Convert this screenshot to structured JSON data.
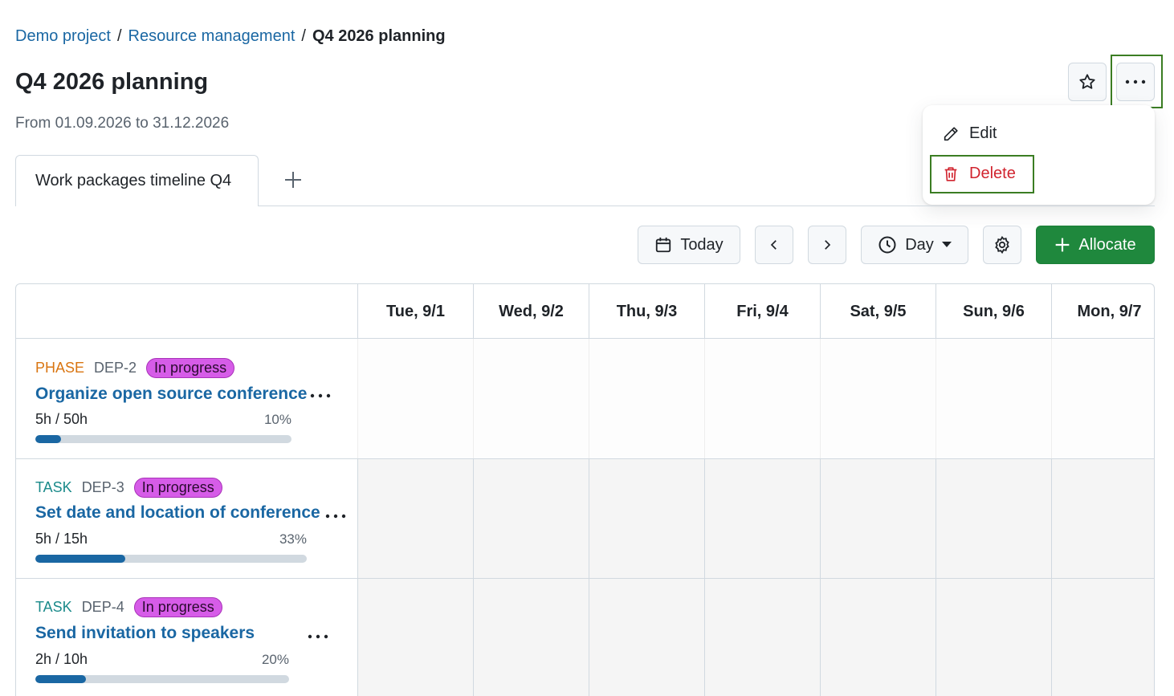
{
  "breadcrumb": {
    "item1": "Demo project",
    "sep1": "/",
    "item2": "Resource management",
    "sep2": "/",
    "current": "Q4 2026 planning"
  },
  "page": {
    "title": "Q4 2026 planning",
    "date_range": "From 01.09.2026 to 31.12.2026"
  },
  "header_actions": {
    "star_icon": "star-icon",
    "more_icon": "kebab-horizontal-icon"
  },
  "menu": {
    "edit_label": "Edit",
    "delete_label": "Delete"
  },
  "tabs": {
    "active_label": "Work packages timeline Q4",
    "add_icon": "plus-icon"
  },
  "toolbar": {
    "today_label": "Today",
    "zoom_label": "Day",
    "allocate_label": "Allocate"
  },
  "days": [
    "Tue, 9/1",
    "Wed, 9/2",
    "Thu, 9/3",
    "Fri, 9/4",
    "Sat, 9/5",
    "Sun, 9/6",
    "Mon, 9/7"
  ],
  "rows": [
    {
      "type": "PHASE",
      "id": "DEP-2",
      "status": "In progress",
      "title": "Organize open source conference",
      "hours": "5h / 50h",
      "percent_label": "10%",
      "progress": 0.1
    },
    {
      "type": "TASK",
      "id": "DEP-3",
      "status": "In progress",
      "title": "Set date and location of conference",
      "hours": "5h / 15h",
      "percent_label": "33%",
      "progress": 0.33
    },
    {
      "type": "TASK",
      "id": "DEP-4",
      "status": "In progress",
      "title": "Send invitation to speakers",
      "hours": "2h / 10h",
      "percent_label": "20%",
      "progress": 0.2
    }
  ],
  "colors": {
    "link": "#1a67a3",
    "primary_button": "#1f883d",
    "danger": "#d1242f",
    "status_badge": "#d65ce8",
    "phase_type": "#d97511",
    "task_type": "#1a8a8a",
    "highlight_outline": "#3b7d23"
  }
}
